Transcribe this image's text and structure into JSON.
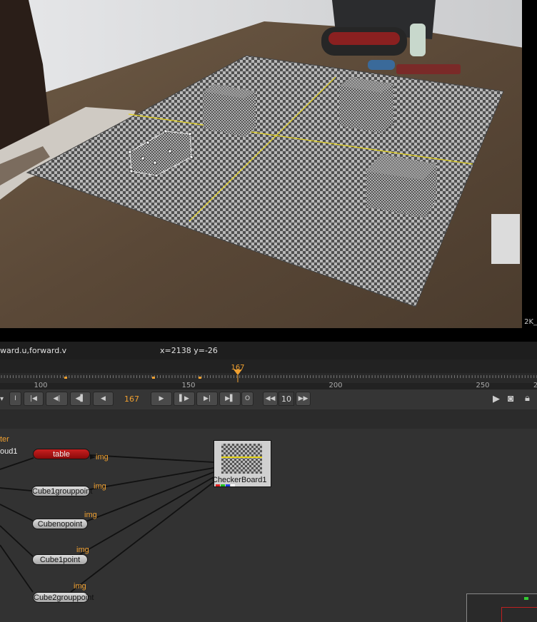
{
  "viewer": {
    "resolution_label": "2K_",
    "colors": {
      "checker_dark": "#505050",
      "checker_light": "#b8b8b8",
      "axis": "#e6d41a",
      "selection": "#ffffff"
    }
  },
  "info_bar": {
    "channels": "ward.u,forward.v",
    "coordinates": "x=2138 y=-26"
  },
  "timeline": {
    "current_frame": "167",
    "tick_labels": [
      "100",
      "150",
      "200",
      "250"
    ],
    "partial_label": "2"
  },
  "transport": {
    "buttons": [
      {
        "name": "in-point-button",
        "glyph": "I"
      },
      {
        "name": "first-frame-button",
        "glyph": "|◀"
      },
      {
        "name": "prev-keyframe-button",
        "glyph": "◀|"
      },
      {
        "name": "prev-frame-button",
        "glyph": "◀▌"
      },
      {
        "name": "play-backward-button",
        "glyph": "◀"
      },
      {
        "name": "play-forward-button",
        "glyph": "▶"
      },
      {
        "name": "next-frame-button",
        "glyph": "▌▶"
      },
      {
        "name": "next-keyframe-button",
        "glyph": "▶|"
      },
      {
        "name": "last-frame-button",
        "glyph": "▶▌"
      },
      {
        "name": "out-point-button",
        "glyph": "O"
      },
      {
        "name": "skip-back-button",
        "glyph": "◀◀"
      },
      {
        "name": "skip-forward-button",
        "glyph": "▶▶"
      }
    ],
    "frame": "167",
    "step": "10"
  },
  "node_graph": {
    "left_labels": {
      "top": "ter",
      "second": "oud1"
    },
    "nodes": {
      "table": "table",
      "cube1grouppoint": "Cube1grouppoint",
      "cubenopoint": "Cubenopoint",
      "cube1point": "Cube1point",
      "cube2grouppoint": "Cube2grouppoint",
      "checkerboard": "CheckerBoard1"
    },
    "input_label": "img",
    "colors": {
      "accent": "#f0a030",
      "red_node": "#a81515"
    }
  }
}
